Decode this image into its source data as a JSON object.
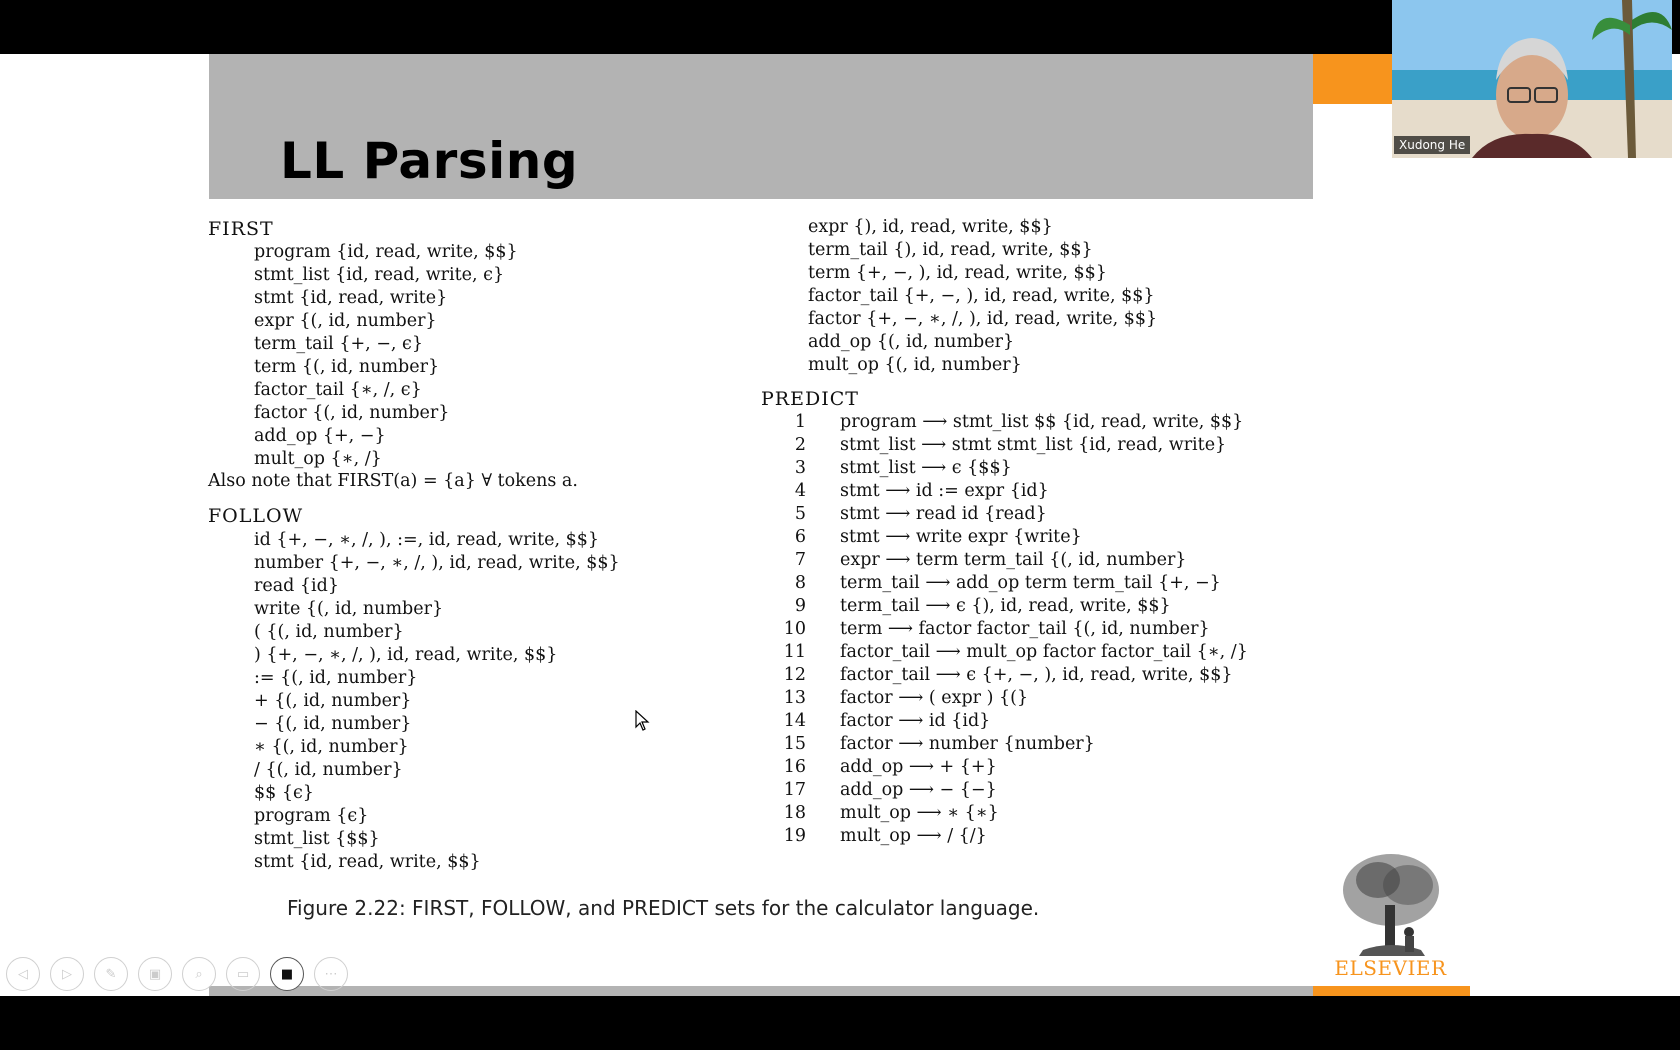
{
  "slide": {
    "title": "LL Parsing",
    "caption": "Figure 2.22: FIRST, FOLLOW, and PREDICT sets for the calculator language.",
    "publisher": "ELSEVIER"
  },
  "first": {
    "heading": "FIRST",
    "lines": [
      "program {id, read, write, $$}",
      "stmt_list {id, read, write, ϵ}",
      "stmt {id, read, write}",
      "expr {(, id, number}",
      "term_tail {+, −, ϵ}",
      "term {(, id, number}",
      "factor_tail {∗, /, ϵ}",
      "factor {(, id, number}",
      "add_op {+, −}",
      "mult_op {∗, /}"
    ],
    "note": "Also note that FIRST(a) = {a} ∀ tokens a."
  },
  "follow": {
    "heading": "FOLLOW",
    "lines": [
      "id {+, −, ∗, /, ), :=, id, read, write, $$}",
      "number {+, −, ∗, /, ), id, read, write, $$}",
      "read {id}",
      "write {(, id, number}",
      "( {(, id, number}",
      ") {+, −, ∗, /, ), id, read, write, $$}",
      ":= {(, id, number}",
      "+ {(, id, number}",
      "− {(, id, number}",
      "∗ {(, id, number}",
      "/ {(, id, number}",
      "$$ {ϵ}",
      "program {ϵ}",
      "stmt_list {$$}",
      "stmt {id, read, write, $$}"
    ],
    "continued": [
      "expr {), id, read, write, $$}",
      "term_tail {), id, read, write, $$}",
      "term {+, −, ), id, read, write, $$}",
      "factor_tail {+, −, ), id, read, write, $$}",
      "factor {+, −, ∗, /, ), id, read, write, $$}",
      "add_op {(, id, number}",
      "mult_op {(, id, number}"
    ]
  },
  "predict": {
    "heading": "PREDICT",
    "rows": [
      {
        "n": "1",
        "rule": "program ⟶ stmt_list $$ {id, read, write, $$}"
      },
      {
        "n": "2",
        "rule": "stmt_list ⟶ stmt stmt_list {id, read, write}"
      },
      {
        "n": "3",
        "rule": "stmt_list ⟶ ϵ {$$}"
      },
      {
        "n": "4",
        "rule": "stmt ⟶ id := expr {id}"
      },
      {
        "n": "5",
        "rule": "stmt ⟶ read id {read}"
      },
      {
        "n": "6",
        "rule": "stmt ⟶ write expr {write}"
      },
      {
        "n": "7",
        "rule": "expr ⟶ term term_tail {(, id, number}"
      },
      {
        "n": "8",
        "rule": "term_tail ⟶ add_op term term_tail {+, −}"
      },
      {
        "n": "9",
        "rule": "term_tail ⟶ ϵ {), id, read, write, $$}"
      },
      {
        "n": "10",
        "rule": "term ⟶ factor factor_tail {(, id, number}"
      },
      {
        "n": "11",
        "rule": "factor_tail ⟶ mult_op factor factor_tail {∗, /}"
      },
      {
        "n": "12",
        "rule": "factor_tail ⟶ ϵ {+, −, ), id, read, write, $$}"
      },
      {
        "n": "13",
        "rule": "factor ⟶ ( expr ) {(}"
      },
      {
        "n": "14",
        "rule": "factor ⟶ id {id}"
      },
      {
        "n": "15",
        "rule": "factor ⟶ number {number}"
      },
      {
        "n": "16",
        "rule": "add_op ⟶ + {+}"
      },
      {
        "n": "17",
        "rule": "add_op ⟶ − {−}"
      },
      {
        "n": "18",
        "rule": "mult_op ⟶ ∗ {∗}"
      },
      {
        "n": "19",
        "rule": "mult_op ⟶ / {/}"
      }
    ]
  },
  "video": {
    "participant_name": "Xudong He"
  },
  "controls": [
    {
      "icon": "previous-icon",
      "glyph": "◁"
    },
    {
      "icon": "next-icon",
      "glyph": "▷"
    },
    {
      "icon": "pen-icon",
      "glyph": "✎"
    },
    {
      "icon": "slides-icon",
      "glyph": "▣"
    },
    {
      "icon": "zoom-icon",
      "glyph": "⌕"
    },
    {
      "icon": "subtitles-icon",
      "glyph": "▭"
    },
    {
      "icon": "camera-icon",
      "glyph": "■"
    },
    {
      "icon": "more-icon",
      "glyph": "⋯"
    }
  ],
  "colors": {
    "accent": "#f7941d",
    "header_band": "#b3b3b3"
  }
}
